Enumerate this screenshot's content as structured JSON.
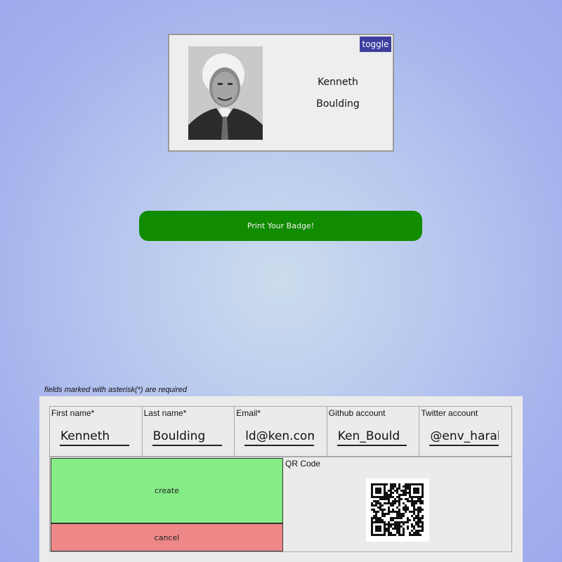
{
  "badge": {
    "first_name": "Kenneth",
    "last_name": "Boulding",
    "toggle_label": "toggle"
  },
  "print_button_label": "Print Your Badge!",
  "form": {
    "required_note": "fields marked with asterisk(*) are required",
    "fields": [
      {
        "label": "First name*",
        "value": "Kenneth"
      },
      {
        "label": "Last name*",
        "value": "Boulding"
      },
      {
        "label": "Email*",
        "value": "ld@ken.com"
      },
      {
        "label": "Github account",
        "value": "Ken_Bould"
      },
      {
        "label": "Twitter account",
        "value": "@env_harald"
      }
    ],
    "create_label": "create",
    "cancel_label": "cancel",
    "qr_label": "QR Code"
  },
  "colors": {
    "toggle_bg": "#3d3e9e",
    "print_button_bg": "#118b00",
    "create_bg": "#86ec86",
    "cancel_bg": "#ee8888",
    "panel_bg": "#ebebeb"
  }
}
